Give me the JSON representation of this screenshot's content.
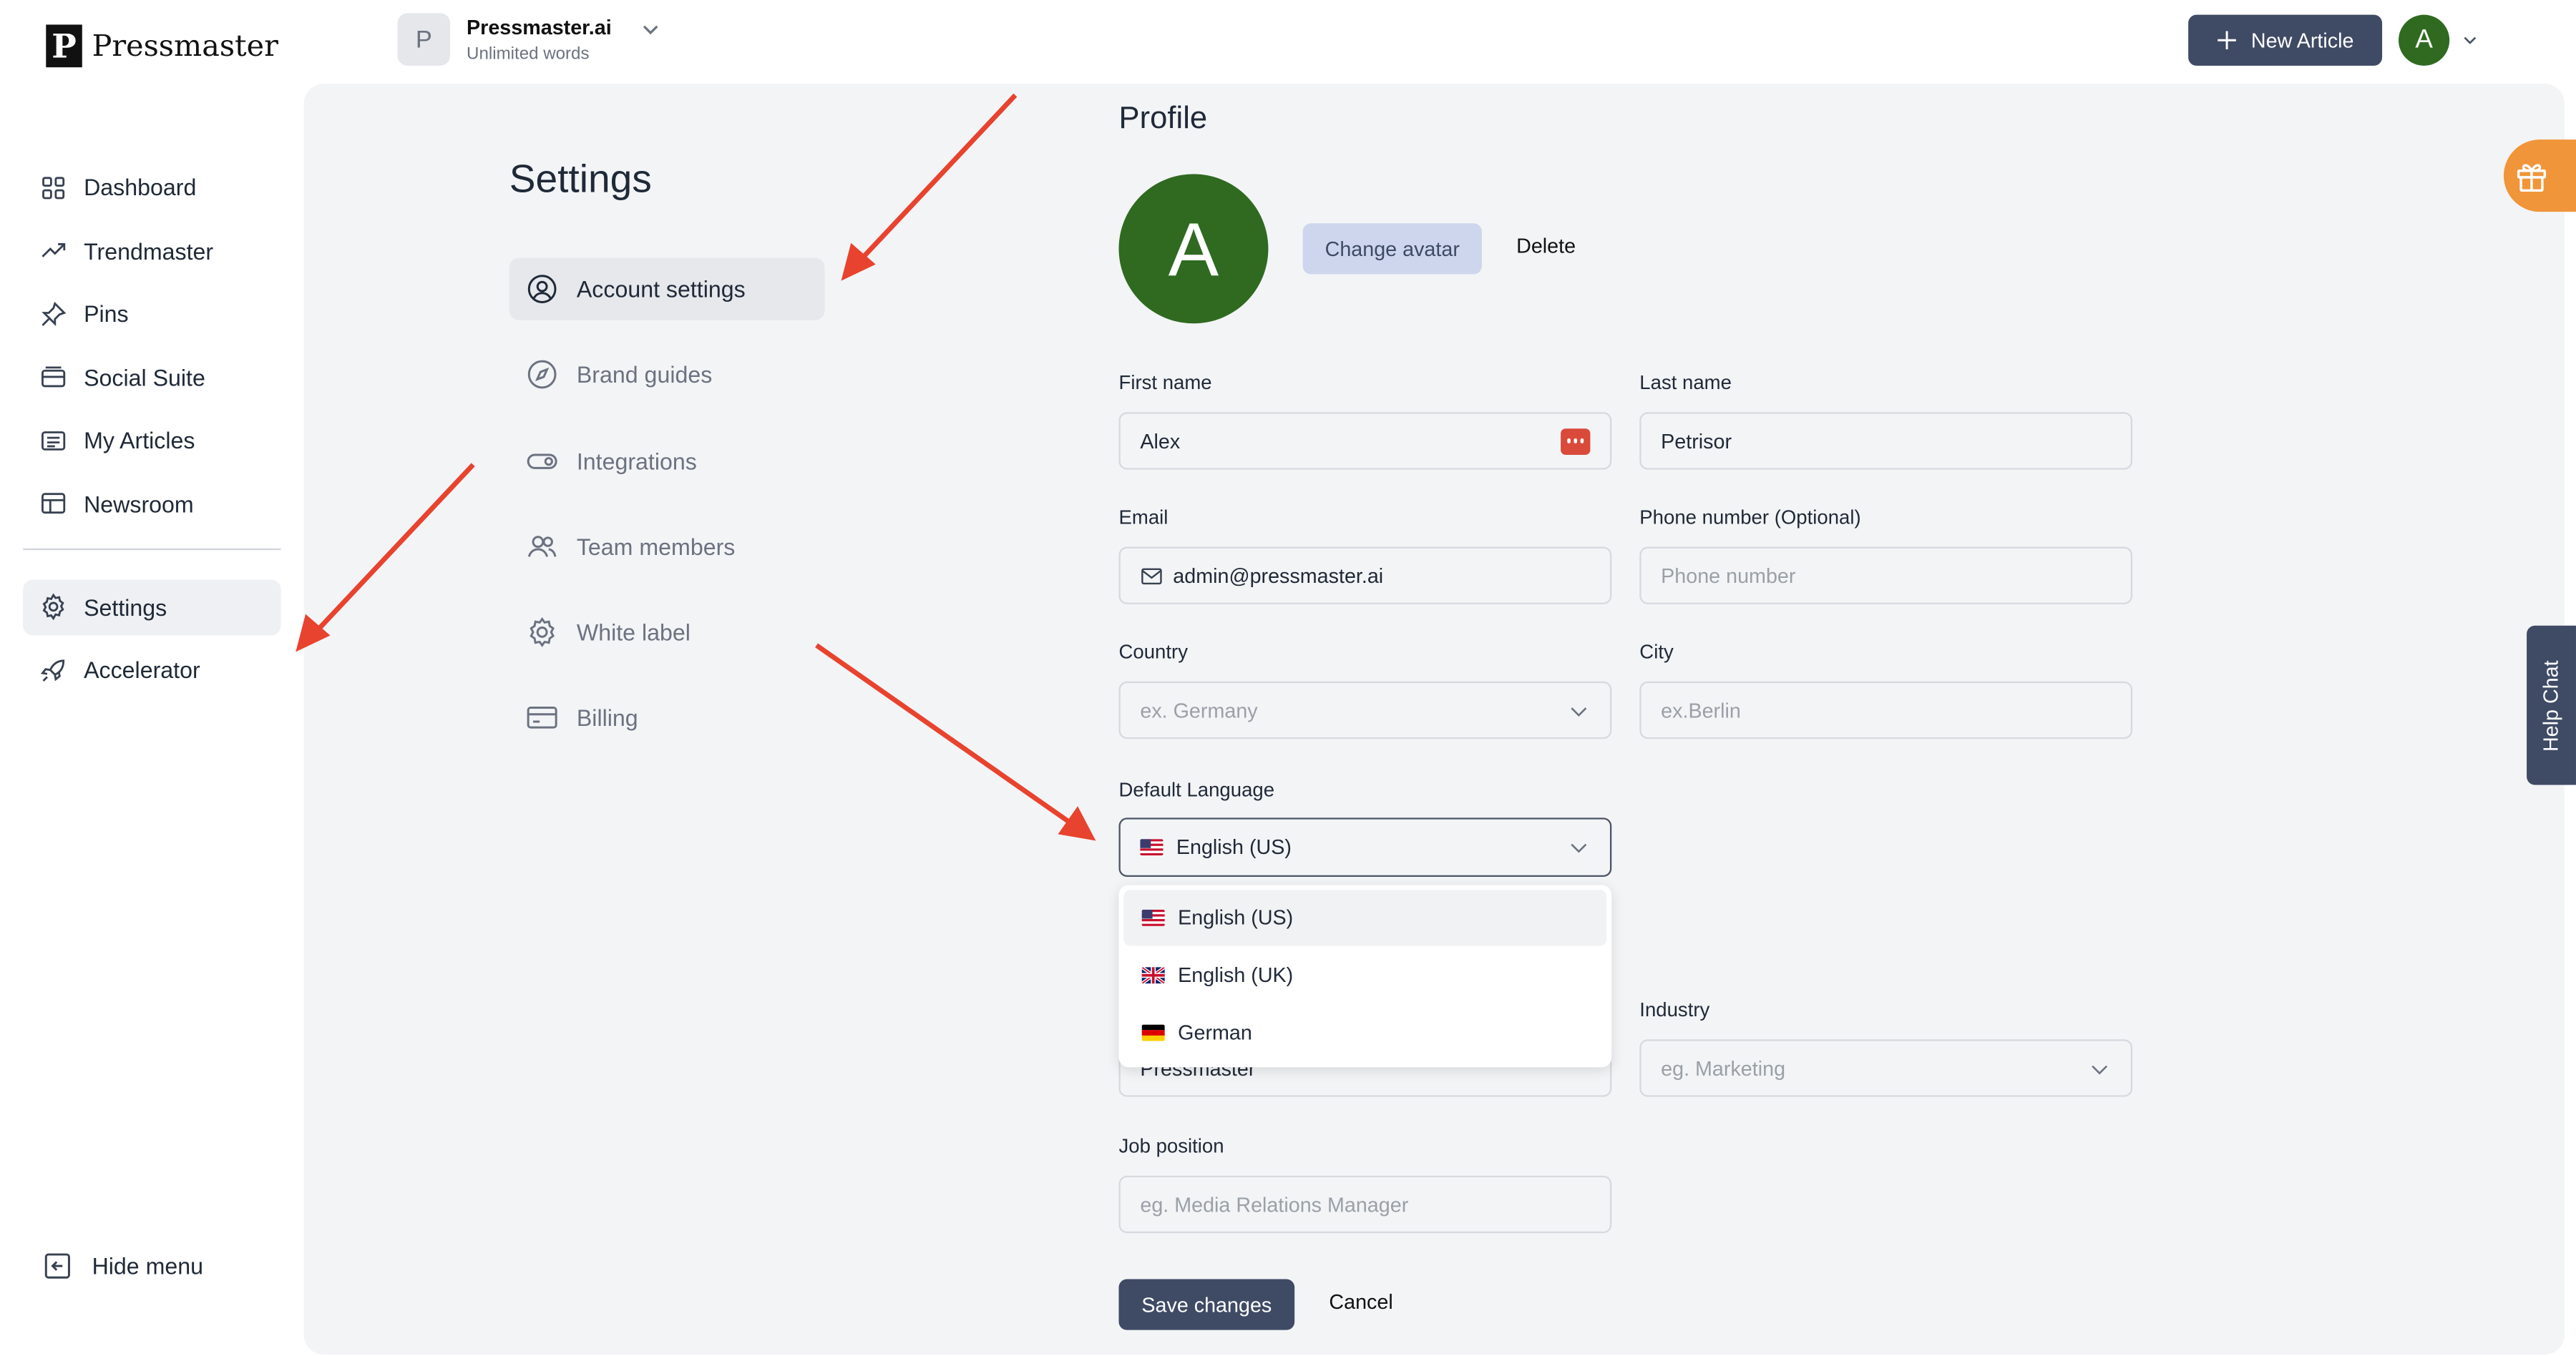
{
  "brand": {
    "name": "Pressmaster",
    "mark": "P"
  },
  "workspace": {
    "initial": "P",
    "name": "Pressmaster.ai",
    "plan": "Unlimited words"
  },
  "header": {
    "new_article_label": "New Article",
    "user_initial": "A"
  },
  "sidebar": {
    "items": [
      {
        "label": "Dashboard",
        "icon": "grid-icon"
      },
      {
        "label": "Trendmaster",
        "icon": "trending-up-icon"
      },
      {
        "label": "Pins",
        "icon": "pin-icon"
      },
      {
        "label": "Social Suite",
        "icon": "social-suite-icon"
      },
      {
        "label": "My Articles",
        "icon": "articles-icon"
      },
      {
        "label": "Newsroom",
        "icon": "newsroom-icon"
      }
    ],
    "bottom_items": [
      {
        "label": "Settings",
        "icon": "gear-icon",
        "active": true
      },
      {
        "label": "Accelerator",
        "icon": "rocket-icon"
      }
    ],
    "hide_menu_label": "Hide menu"
  },
  "settings": {
    "title": "Settings",
    "menu": [
      {
        "label": "Account settings",
        "icon": "user-circle-icon",
        "active": true
      },
      {
        "label": "Brand guides",
        "icon": "compass-icon"
      },
      {
        "label": "Integrations",
        "icon": "toggle-icon"
      },
      {
        "label": "Team members",
        "icon": "users-icon"
      },
      {
        "label": "White label",
        "icon": "gear-icon"
      },
      {
        "label": "Billing",
        "icon": "credit-card-icon"
      }
    ]
  },
  "profile": {
    "heading": "Profile",
    "avatar_initial": "A",
    "change_avatar_label": "Change avatar",
    "delete_label": "Delete",
    "first_name": {
      "label": "First name",
      "value": "Alex"
    },
    "last_name": {
      "label": "Last name",
      "value": "Petrisor"
    },
    "email": {
      "label": "Email",
      "value": "admin@pressmaster.ai"
    },
    "phone": {
      "label": "Phone number (Optional)",
      "placeholder": "Phone number"
    },
    "country": {
      "label": "Country",
      "placeholder": "ex. Germany"
    },
    "city": {
      "label": "City",
      "placeholder": "ex.Berlin"
    },
    "default_language": {
      "label": "Default Language",
      "selected": "English (US)",
      "options": [
        "English (US)",
        "English (UK)",
        "German"
      ]
    },
    "company": {
      "value_partial": "Pressmaster"
    },
    "industry": {
      "label": "Industry",
      "placeholder": "eg. Marketing"
    },
    "job_position": {
      "label": "Job position",
      "placeholder": "eg. Media Relations Manager"
    },
    "save_label": "Save changes",
    "cancel_label": "Cancel"
  },
  "widgets": {
    "help_chat_label": "Help Chat"
  },
  "colors": {
    "primary": "#3f4a64",
    "avatar_green": "#2f6a20",
    "annotation_arrow": "#e8432e",
    "gift_orange": "#f0953a",
    "password_badge": "#d94a3b"
  }
}
